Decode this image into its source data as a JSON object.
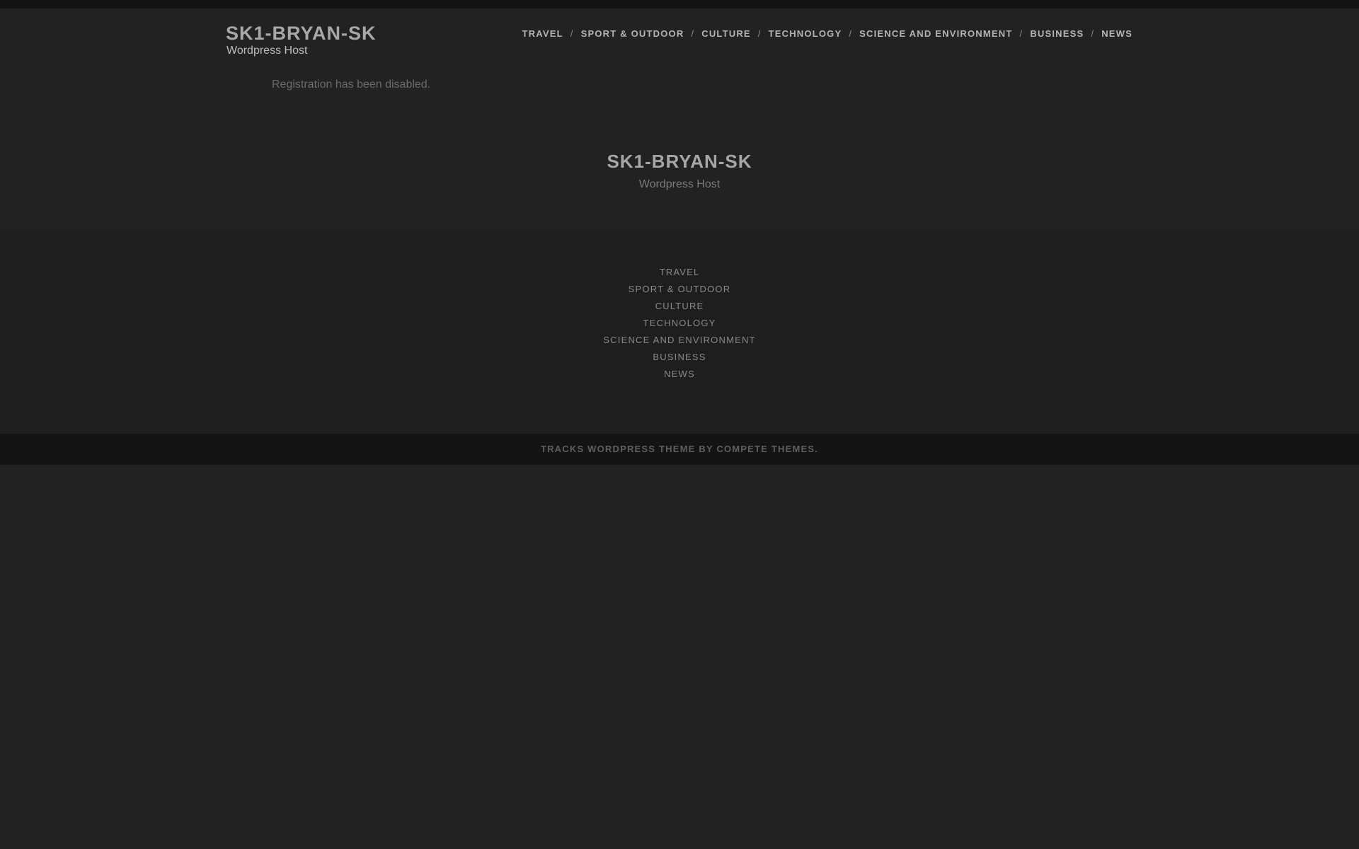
{
  "header": {
    "site_title": "SK1-BRYAN-SK",
    "tagline": "Wordpress Host",
    "nav": [
      {
        "label": "TRAVEL"
      },
      {
        "label": "SPORT & OUTDOOR"
      },
      {
        "label": "CULTURE"
      },
      {
        "label": "TECHNOLOGY"
      },
      {
        "label": "SCIENCE AND ENVIRONMENT"
      },
      {
        "label": "BUSINESS"
      },
      {
        "label": "NEWS"
      }
    ],
    "separator": "/"
  },
  "main": {
    "notice": "Registration has been disabled."
  },
  "site_info": {
    "title": "SK1-BRYAN-SK",
    "tagline": "Wordpress Host"
  },
  "footer_nav": [
    {
      "label": "TRAVEL"
    },
    {
      "label": "SPORT & OUTDOOR"
    },
    {
      "label": "CULTURE"
    },
    {
      "label": "TECHNOLOGY"
    },
    {
      "label": "SCIENCE AND ENVIRONMENT"
    },
    {
      "label": "BUSINESS"
    },
    {
      "label": "NEWS"
    }
  ],
  "credits": {
    "theme_link": "TRACKS WORDPRESS THEME",
    "by_text": "BY",
    "author_link": "COMPETE THEMES.",
    "text_color": "#5f5f5f"
  },
  "colors": {
    "page_background": "#222222",
    "top_bar": "#141414",
    "footer_background": "#1e1e1e",
    "credits_background": "#141414"
  }
}
